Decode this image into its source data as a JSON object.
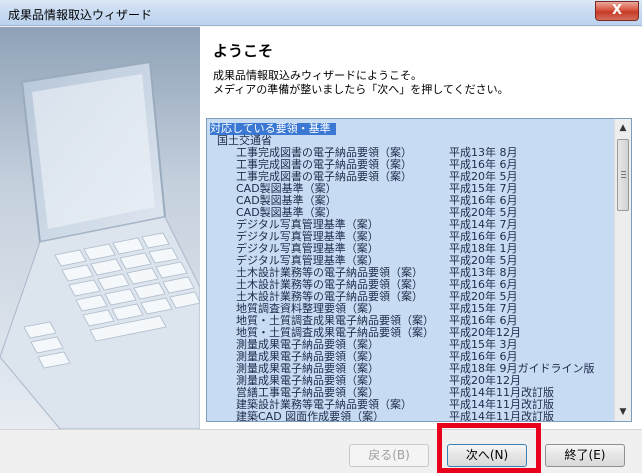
{
  "window": {
    "title": "成果品情報取込ウィザード",
    "close_label": "X"
  },
  "header": {
    "title": "ようこそ",
    "line1": "成果品情報取込みウィザードにようこそ。",
    "line2": "メディアの準備が整いましたら「次へ」を押してください。"
  },
  "list": {
    "heading": "対応している要領・基準",
    "group": "国土交通省",
    "items": [
      {
        "name": "工事完成図書の電子納品要領（案）",
        "date": "平成13年 8月"
      },
      {
        "name": "工事完成図書の電子納品要領（案）",
        "date": "平成16年 6月"
      },
      {
        "name": "工事完成図書の電子納品要領（案）",
        "date": "平成20年 5月"
      },
      {
        "name": "CAD製図基準（案）",
        "date": "平成15年 7月"
      },
      {
        "name": "CAD製図基準（案）",
        "date": "平成16年 6月"
      },
      {
        "name": "CAD製図基準（案）",
        "date": "平成20年 5月"
      },
      {
        "name": "デジタル写真管理基準（案）",
        "date": "平成14年 7月"
      },
      {
        "name": "デジタル写真管理基準（案）",
        "date": "平成16年 6月"
      },
      {
        "name": "デジタル写真管理基準（案）",
        "date": "平成18年 1月"
      },
      {
        "name": "デジタル写真管理基準（案）",
        "date": "平成20年 5月"
      },
      {
        "name": "土木設計業務等の電子納品要領（案）",
        "date": "平成13年 8月"
      },
      {
        "name": "土木設計業務等の電子納品要領（案）",
        "date": "平成16年 6月"
      },
      {
        "name": "土木設計業務等の電子納品要領（案）",
        "date": "平成20年 5月"
      },
      {
        "name": "地質調査資料整理要領（案）",
        "date": "平成15年 7月"
      },
      {
        "name": "地質・土質調査成果電子納品要領（案）",
        "date": "平成16年 6月"
      },
      {
        "name": "地質・土質調査成果電子納品要領（案）",
        "date": "平成20年12月"
      },
      {
        "name": "測量成果電子納品要領（案）",
        "date": "平成15年 3月"
      },
      {
        "name": "測量成果電子納品要領（案）",
        "date": "平成16年 6月"
      },
      {
        "name": "測量成果電子納品要領（案）",
        "date": "平成18年 9月ガイドライン版"
      },
      {
        "name": "測量成果電子納品要領（案）",
        "date": "平成20年12月"
      },
      {
        "name": "営繕工事電子納品要領（案）",
        "date": "平成14年11月改訂版"
      },
      {
        "name": "建築設計業務等電子納品要領（案）",
        "date": "平成14年11月改訂版"
      },
      {
        "name": "建築CAD 図面作成要領（案）",
        "date": "平成14年11月改訂版"
      }
    ]
  },
  "buttons": {
    "back": "戻る(B)",
    "next": "次へ(N)",
    "finish": "終了(E)"
  },
  "colors": {
    "selection": "#3a78d4",
    "highlight_frame": "#e8001c",
    "list_bg": "#c7dcf3"
  }
}
